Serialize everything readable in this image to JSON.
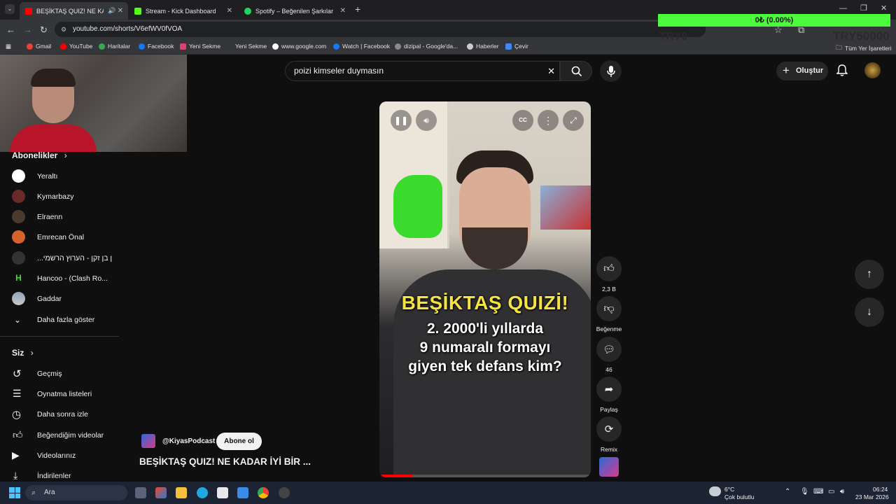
{
  "browser": {
    "tabs": [
      {
        "label": "BEŞİKTAŞ QUIZ! NE KADAR",
        "active": true
      },
      {
        "label": "Stream - Kick Dashboard",
        "active": false
      },
      {
        "label": "Spotify – Beğenilen Şarkılar",
        "active": false
      }
    ],
    "url": "youtube.com/shorts/V6efWV0fVOA",
    "bookmarks": [
      "Gmail",
      "YouTube",
      "Haritalar",
      "Facebook",
      "Yeni Sekme",
      "Yeni Sekme",
      "www.google.com",
      "Watch | Facebook",
      "dizipal - Google'da...",
      "Haberler",
      "Çevir"
    ],
    "all_bookmarks": "Tüm Yer İşaretleri"
  },
  "overlay": {
    "progress_text": "0₺ (0.00%)",
    "left_label": "TRY0",
    "right_label": "TRY50000"
  },
  "youtube": {
    "search_value": "poizi kimseler duymasın",
    "create_label": "Oluştur",
    "sidebar": {
      "subscriptions_heading": "Abonelikler",
      "channels": [
        "Yeraltı",
        "Kymarbazy",
        "Elraenn",
        "Emrecan Önal",
        "...ן בן זקן - הערוץ הרשמי",
        "Hancoo - (Clash Ro...",
        "Gaddar"
      ],
      "show_more": "Daha fazla göster",
      "you_heading": "Siz",
      "you_items": [
        "Geçmiş",
        "Oynatma listeleri",
        "Daha sonra izle",
        "Beğendiğim videolar",
        "Videolarınız",
        "İndirilenler"
      ]
    },
    "short": {
      "title_line": "BEŞİKTAŞ QUIZİ!",
      "question_lines": [
        "2. 2000'li yıllarda",
        "9 numaralı formayı",
        "giyen tek defans kim?"
      ],
      "channel": "@KiyasPodcast",
      "subscribe_label": "Abone ol",
      "video_title": "BEŞİKTAŞ QUIZ! NE KADAR İYİ BİR ..."
    },
    "actions": {
      "likes": "2,3 B",
      "dislike_label": "Beğenme",
      "comments": "46",
      "share_label": "Paylaş",
      "remix_label": "Remix"
    }
  },
  "taskbar": {
    "search_label": "Ara",
    "weather_temp": "6°C",
    "weather_desc": "Çok bulutlu",
    "time": "06:24",
    "date": "23 Mar 2026"
  }
}
